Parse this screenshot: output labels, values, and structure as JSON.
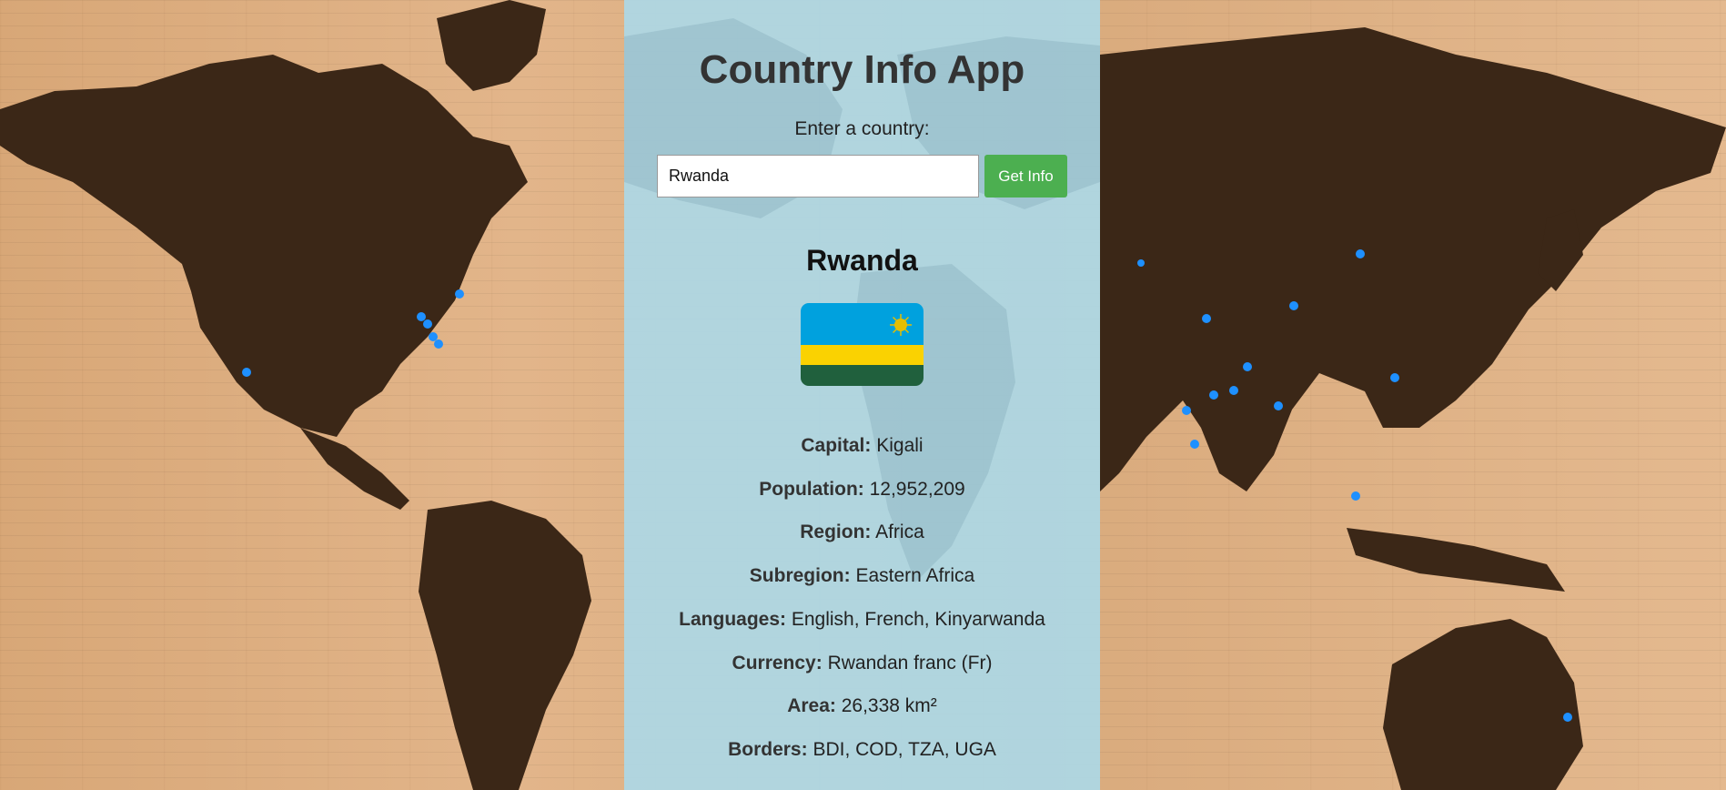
{
  "header": {
    "title": "Country Info App"
  },
  "search": {
    "label": "Enter a country:",
    "value": "Rwanda",
    "button_label": "Get Info"
  },
  "country": {
    "name": "Rwanda",
    "flag_colors": {
      "blue": "#00a1de",
      "yellow": "#fad201",
      "green": "#20603d",
      "sun": "#e5be01"
    },
    "fields": [
      {
        "label": "Capital:",
        "value": "Kigali"
      },
      {
        "label": "Population:",
        "value": "12,952,209"
      },
      {
        "label": "Region:",
        "value": "Africa"
      },
      {
        "label": "Subregion:",
        "value": "Eastern Africa"
      },
      {
        "label": "Languages:",
        "value": "English, French, Kinyarwanda"
      },
      {
        "label": "Currency:",
        "value": "Rwandan franc (Fr)"
      },
      {
        "label": "Area:",
        "value": "26,338 km²"
      },
      {
        "label": "Borders:",
        "value": "BDI, COD, TZA, UGA"
      }
    ]
  },
  "theme": {
    "panel": "#add8e6",
    "button": "#4caf50",
    "map_land": "#3a2616",
    "pin": "#1e90ff"
  }
}
